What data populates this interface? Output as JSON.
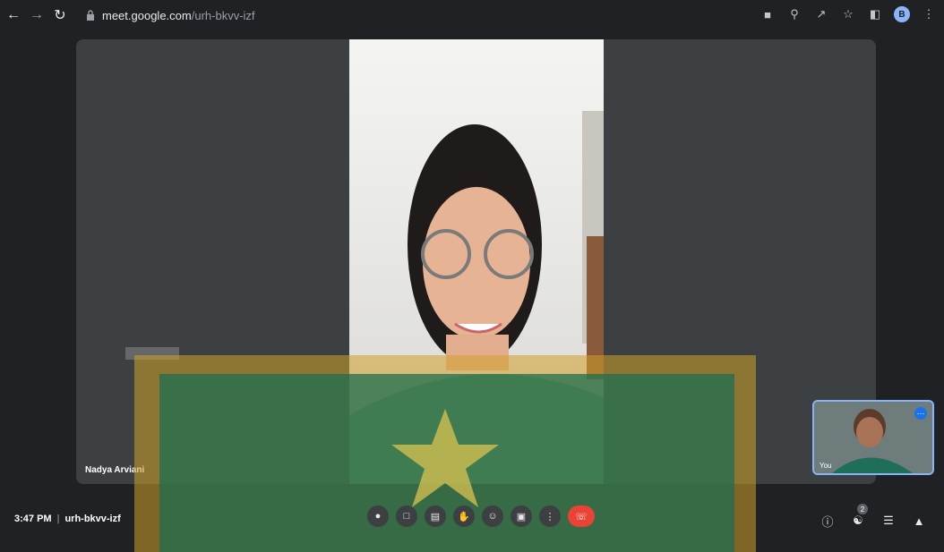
{
  "browser": {
    "url_host": "meet.google.com",
    "url_path": "/urh-bkvv-izf",
    "profile_initial": "B"
  },
  "meeting": {
    "participant_name": "Nadya Arviani",
    "self_label": "You",
    "time": "3:47 PM",
    "separator": "|",
    "code": "urh-bkvv-izf",
    "participant_count": "2"
  },
  "colors": {
    "accent": "#8ab4f8",
    "end_call": "#ea4335",
    "tile_bg": "#3c4043"
  }
}
